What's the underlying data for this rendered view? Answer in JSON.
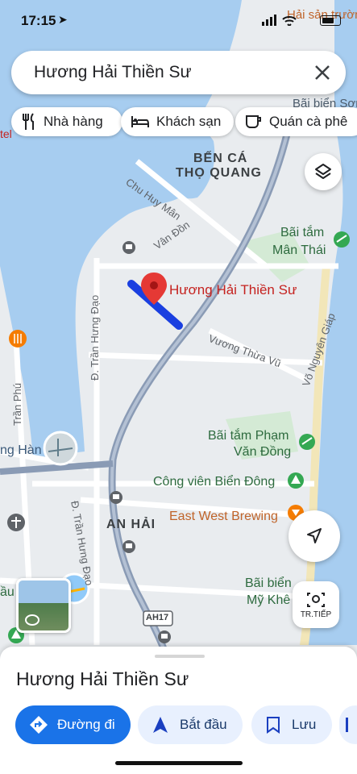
{
  "status_bar": {
    "time": "17:15"
  },
  "search": {
    "query": "Hương Hải Thiền Sư"
  },
  "chips": [
    {
      "label": "Nhà hàng",
      "icon": "fork-knife-icon"
    },
    {
      "label": "Khách sạn",
      "icon": "bed-icon"
    },
    {
      "label": "Quán cà phê",
      "icon": "coffee-cup-icon"
    }
  ],
  "map": {
    "labels": {
      "hai_san_truong": "Hải sản trường",
      "bai_bien_son": "Bãi biển Sơn",
      "hotel": "tel",
      "ben_ca_1": "BẾN CÁ",
      "ben_ca_2": "THỌ QUANG",
      "chu_huy_man": "Chu Huy Mân",
      "van_don": "Vân Đồn",
      "bai_tam_man_thai_1": "Bãi tắm",
      "bai_tam_man_thai_2": "Mân Thái",
      "tran_hung_dao_1": "Đ. Trần Hưng Đạo",
      "vuong_thua_vu": "Vương Thừa Vũ",
      "vo_nguyen_giap": "Võ Nguyên Giáp",
      "tran_phu": "Trần Phú",
      "song_han": "ng Hàn",
      "bai_tam_pham_1": "Bãi tắm Phạm",
      "bai_tam_pham_2": "Văn Đồng",
      "cong_vien": "Công viên Biển Đông",
      "east_west": "East West Brewing",
      "tran_hung_dao_2": "Đ. Trần Hưng Đạo",
      "an_hai": "AN HẢI",
      "dau": "ầu",
      "bai_bien_my_khe_1": "Bãi biển",
      "bai_bien_my_khe_2": "Mỹ Khê",
      "ah17": "AH17"
    },
    "place_marker_label": "Hương Hải Thiền Sư",
    "tr_tiep_label": "TR.TIẾP"
  },
  "sheet": {
    "title": "Hương Hải Thiền Sư",
    "actions": {
      "directions": "Đường đi",
      "start": "Bắt đầu",
      "save": "Lưu"
    }
  },
  "colors": {
    "water": "#a7cdf0",
    "land": "#e9ecef",
    "highway": "#8a9bb5",
    "route": "#1a3fe0",
    "marker": "#e53935",
    "accent_button": "#1a73e8",
    "chip_bg": "#e8f0fe"
  }
}
